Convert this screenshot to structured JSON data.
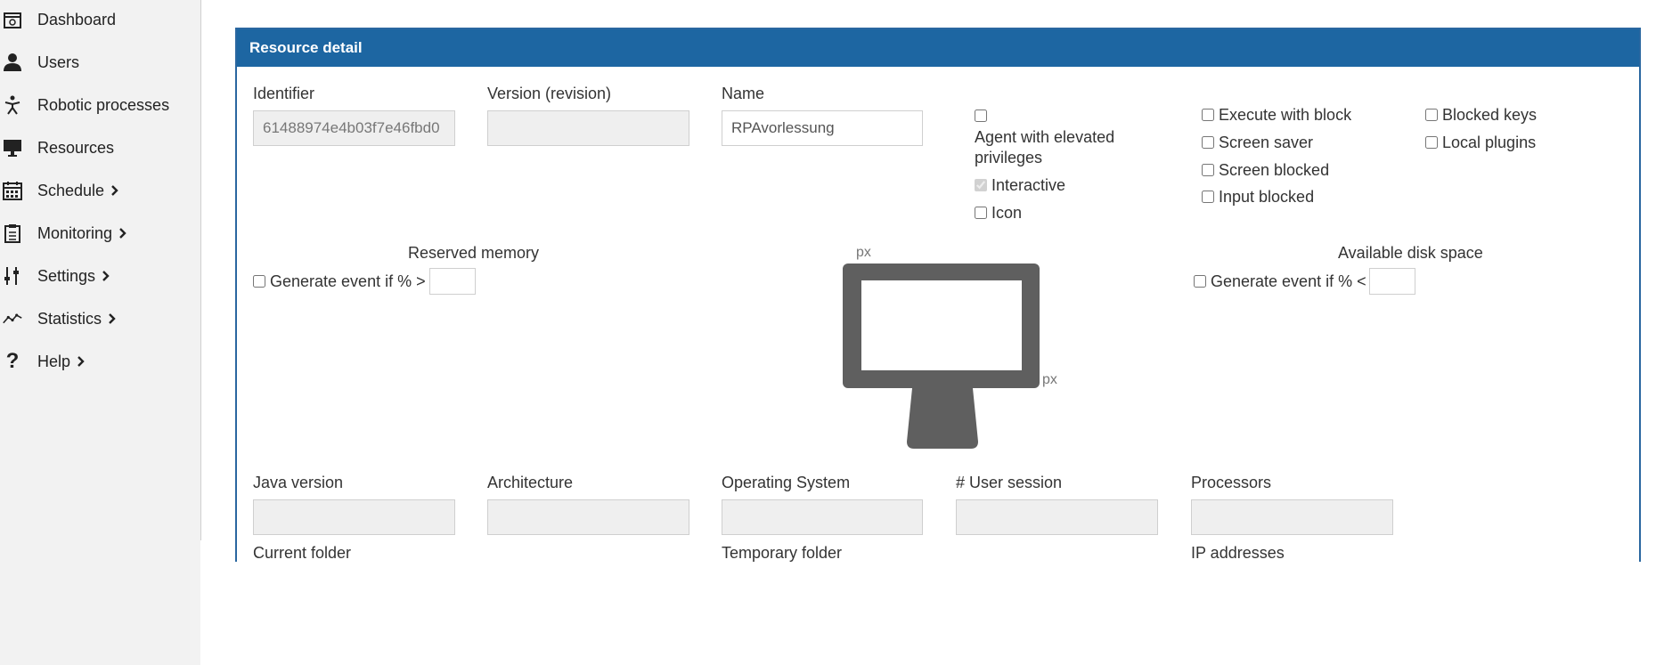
{
  "sidebar": {
    "items": [
      {
        "label": "Dashboard",
        "icon": "dashboard-icon",
        "has_submenu": false
      },
      {
        "label": "Users",
        "icon": "user-icon",
        "has_submenu": false
      },
      {
        "label": "Robotic processes",
        "icon": "robot-icon",
        "has_submenu": false
      },
      {
        "label": "Resources",
        "icon": "monitor-icon",
        "has_submenu": false
      },
      {
        "label": "Schedule",
        "icon": "calendar-icon",
        "has_submenu": true
      },
      {
        "label": "Monitoring",
        "icon": "clipboard-icon",
        "has_submenu": true
      },
      {
        "label": "Settings",
        "icon": "sliders-icon",
        "has_submenu": true
      },
      {
        "label": "Statistics",
        "icon": "chart-line-icon",
        "has_submenu": true
      },
      {
        "label": "Help",
        "icon": "question-icon",
        "has_submenu": true
      }
    ]
  },
  "panel": {
    "title": "Resource detail",
    "identifier": {
      "label": "Identifier",
      "value": "61488974e4b03f7e46fbd0"
    },
    "version": {
      "label": "Version (revision)",
      "value": ""
    },
    "name": {
      "label": "Name",
      "value": "RPAvorlessung"
    },
    "checkboxes": {
      "agent_elevated": {
        "label": "Agent with elevated privileges",
        "checked": false
      },
      "interactive": {
        "label": "Interactive",
        "checked": true,
        "disabled": true
      },
      "icon": {
        "label": "Icon",
        "checked": false
      },
      "execute_with_block": {
        "label": "Execute with block",
        "checked": false
      },
      "screen_saver": {
        "label": "Screen saver",
        "checked": false
      },
      "screen_blocked": {
        "label": "Screen blocked",
        "checked": false
      },
      "input_blocked": {
        "label": "Input blocked",
        "checked": false
      },
      "blocked_keys": {
        "label": "Blocked keys",
        "checked": false
      },
      "local_plugins": {
        "label": "Local plugins",
        "checked": false
      }
    },
    "reserved_memory": {
      "title": "Reserved memory",
      "event_label": "Generate event if % >",
      "value": ""
    },
    "available_disk": {
      "title": "Available disk space",
      "event_label": "Generate event if % <",
      "value": ""
    },
    "screen": {
      "width_unit": "px",
      "height_unit": "px"
    },
    "java_version": {
      "label": "Java version",
      "value": ""
    },
    "architecture": {
      "label": "Architecture",
      "value": ""
    },
    "operating_system": {
      "label": "Operating System",
      "value": ""
    },
    "user_session": {
      "label": "# User session",
      "value": ""
    },
    "processors": {
      "label": "Processors",
      "value": ""
    },
    "current_folder": {
      "label": "Current folder"
    },
    "temporary_folder": {
      "label": "Temporary folder"
    },
    "ip_addresses": {
      "label": "IP addresses"
    }
  },
  "colors": {
    "header": "#1d66a2",
    "sidebar_bg": "#f2f2f2",
    "monitor": "#5f5f5f"
  }
}
